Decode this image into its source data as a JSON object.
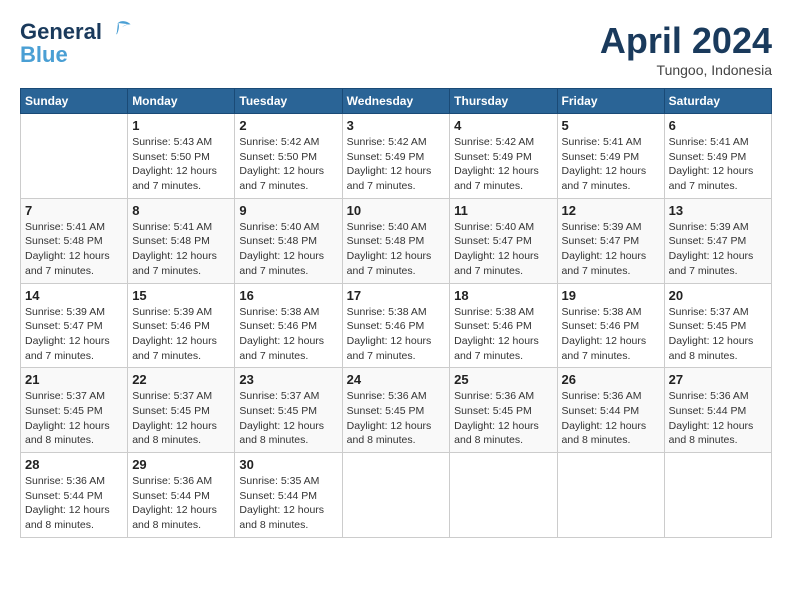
{
  "header": {
    "logo_line1": "General",
    "logo_line2": "Blue",
    "month": "April 2024",
    "location": "Tungoo, Indonesia"
  },
  "days_of_week": [
    "Sunday",
    "Monday",
    "Tuesday",
    "Wednesday",
    "Thursday",
    "Friday",
    "Saturday"
  ],
  "weeks": [
    [
      {
        "day": "",
        "info": ""
      },
      {
        "day": "1",
        "info": "Sunrise: 5:43 AM\nSunset: 5:50 PM\nDaylight: 12 hours\nand 7 minutes."
      },
      {
        "day": "2",
        "info": "Sunrise: 5:42 AM\nSunset: 5:50 PM\nDaylight: 12 hours\nand 7 minutes."
      },
      {
        "day": "3",
        "info": "Sunrise: 5:42 AM\nSunset: 5:49 PM\nDaylight: 12 hours\nand 7 minutes."
      },
      {
        "day": "4",
        "info": "Sunrise: 5:42 AM\nSunset: 5:49 PM\nDaylight: 12 hours\nand 7 minutes."
      },
      {
        "day": "5",
        "info": "Sunrise: 5:41 AM\nSunset: 5:49 PM\nDaylight: 12 hours\nand 7 minutes."
      },
      {
        "day": "6",
        "info": "Sunrise: 5:41 AM\nSunset: 5:49 PM\nDaylight: 12 hours\nand 7 minutes."
      }
    ],
    [
      {
        "day": "7",
        "info": "Sunrise: 5:41 AM\nSunset: 5:48 PM\nDaylight: 12 hours\nand 7 minutes."
      },
      {
        "day": "8",
        "info": "Sunrise: 5:41 AM\nSunset: 5:48 PM\nDaylight: 12 hours\nand 7 minutes."
      },
      {
        "day": "9",
        "info": "Sunrise: 5:40 AM\nSunset: 5:48 PM\nDaylight: 12 hours\nand 7 minutes."
      },
      {
        "day": "10",
        "info": "Sunrise: 5:40 AM\nSunset: 5:48 PM\nDaylight: 12 hours\nand 7 minutes."
      },
      {
        "day": "11",
        "info": "Sunrise: 5:40 AM\nSunset: 5:47 PM\nDaylight: 12 hours\nand 7 minutes."
      },
      {
        "day": "12",
        "info": "Sunrise: 5:39 AM\nSunset: 5:47 PM\nDaylight: 12 hours\nand 7 minutes."
      },
      {
        "day": "13",
        "info": "Sunrise: 5:39 AM\nSunset: 5:47 PM\nDaylight: 12 hours\nand 7 minutes."
      }
    ],
    [
      {
        "day": "14",
        "info": "Sunrise: 5:39 AM\nSunset: 5:47 PM\nDaylight: 12 hours\nand 7 minutes."
      },
      {
        "day": "15",
        "info": "Sunrise: 5:39 AM\nSunset: 5:46 PM\nDaylight: 12 hours\nand 7 minutes."
      },
      {
        "day": "16",
        "info": "Sunrise: 5:38 AM\nSunset: 5:46 PM\nDaylight: 12 hours\nand 7 minutes."
      },
      {
        "day": "17",
        "info": "Sunrise: 5:38 AM\nSunset: 5:46 PM\nDaylight: 12 hours\nand 7 minutes."
      },
      {
        "day": "18",
        "info": "Sunrise: 5:38 AM\nSunset: 5:46 PM\nDaylight: 12 hours\nand 7 minutes."
      },
      {
        "day": "19",
        "info": "Sunrise: 5:38 AM\nSunset: 5:46 PM\nDaylight: 12 hours\nand 7 minutes."
      },
      {
        "day": "20",
        "info": "Sunrise: 5:37 AM\nSunset: 5:45 PM\nDaylight: 12 hours\nand 8 minutes."
      }
    ],
    [
      {
        "day": "21",
        "info": "Sunrise: 5:37 AM\nSunset: 5:45 PM\nDaylight: 12 hours\nand 8 minutes."
      },
      {
        "day": "22",
        "info": "Sunrise: 5:37 AM\nSunset: 5:45 PM\nDaylight: 12 hours\nand 8 minutes."
      },
      {
        "day": "23",
        "info": "Sunrise: 5:37 AM\nSunset: 5:45 PM\nDaylight: 12 hours\nand 8 minutes."
      },
      {
        "day": "24",
        "info": "Sunrise: 5:36 AM\nSunset: 5:45 PM\nDaylight: 12 hours\nand 8 minutes."
      },
      {
        "day": "25",
        "info": "Sunrise: 5:36 AM\nSunset: 5:45 PM\nDaylight: 12 hours\nand 8 minutes."
      },
      {
        "day": "26",
        "info": "Sunrise: 5:36 AM\nSunset: 5:44 PM\nDaylight: 12 hours\nand 8 minutes."
      },
      {
        "day": "27",
        "info": "Sunrise: 5:36 AM\nSunset: 5:44 PM\nDaylight: 12 hours\nand 8 minutes."
      }
    ],
    [
      {
        "day": "28",
        "info": "Sunrise: 5:36 AM\nSunset: 5:44 PM\nDaylight: 12 hours\nand 8 minutes."
      },
      {
        "day": "29",
        "info": "Sunrise: 5:36 AM\nSunset: 5:44 PM\nDaylight: 12 hours\nand 8 minutes."
      },
      {
        "day": "30",
        "info": "Sunrise: 5:35 AM\nSunset: 5:44 PM\nDaylight: 12 hours\nand 8 minutes."
      },
      {
        "day": "",
        "info": ""
      },
      {
        "day": "",
        "info": ""
      },
      {
        "day": "",
        "info": ""
      },
      {
        "day": "",
        "info": ""
      }
    ]
  ]
}
